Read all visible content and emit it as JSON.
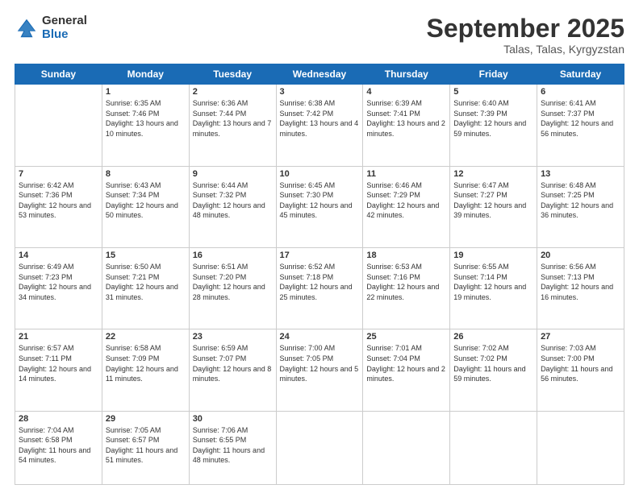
{
  "logo": {
    "general": "General",
    "blue": "Blue"
  },
  "title": "September 2025",
  "location": "Talas, Talas, Kyrgyzstan",
  "days_of_week": [
    "Sunday",
    "Monday",
    "Tuesday",
    "Wednesday",
    "Thursday",
    "Friday",
    "Saturday"
  ],
  "weeks": [
    [
      {
        "day": null,
        "info": null
      },
      {
        "day": "1",
        "sunrise": "Sunrise: 6:35 AM",
        "sunset": "Sunset: 7:46 PM",
        "daylight": "Daylight: 13 hours and 10 minutes."
      },
      {
        "day": "2",
        "sunrise": "Sunrise: 6:36 AM",
        "sunset": "Sunset: 7:44 PM",
        "daylight": "Daylight: 13 hours and 7 minutes."
      },
      {
        "day": "3",
        "sunrise": "Sunrise: 6:38 AM",
        "sunset": "Sunset: 7:42 PM",
        "daylight": "Daylight: 13 hours and 4 minutes."
      },
      {
        "day": "4",
        "sunrise": "Sunrise: 6:39 AM",
        "sunset": "Sunset: 7:41 PM",
        "daylight": "Daylight: 13 hours and 2 minutes."
      },
      {
        "day": "5",
        "sunrise": "Sunrise: 6:40 AM",
        "sunset": "Sunset: 7:39 PM",
        "daylight": "Daylight: 12 hours and 59 minutes."
      },
      {
        "day": "6",
        "sunrise": "Sunrise: 6:41 AM",
        "sunset": "Sunset: 7:37 PM",
        "daylight": "Daylight: 12 hours and 56 minutes."
      }
    ],
    [
      {
        "day": "7",
        "sunrise": "Sunrise: 6:42 AM",
        "sunset": "Sunset: 7:36 PM",
        "daylight": "Daylight: 12 hours and 53 minutes."
      },
      {
        "day": "8",
        "sunrise": "Sunrise: 6:43 AM",
        "sunset": "Sunset: 7:34 PM",
        "daylight": "Daylight: 12 hours and 50 minutes."
      },
      {
        "day": "9",
        "sunrise": "Sunrise: 6:44 AM",
        "sunset": "Sunset: 7:32 PM",
        "daylight": "Daylight: 12 hours and 48 minutes."
      },
      {
        "day": "10",
        "sunrise": "Sunrise: 6:45 AM",
        "sunset": "Sunset: 7:30 PM",
        "daylight": "Daylight: 12 hours and 45 minutes."
      },
      {
        "day": "11",
        "sunrise": "Sunrise: 6:46 AM",
        "sunset": "Sunset: 7:29 PM",
        "daylight": "Daylight: 12 hours and 42 minutes."
      },
      {
        "day": "12",
        "sunrise": "Sunrise: 6:47 AM",
        "sunset": "Sunset: 7:27 PM",
        "daylight": "Daylight: 12 hours and 39 minutes."
      },
      {
        "day": "13",
        "sunrise": "Sunrise: 6:48 AM",
        "sunset": "Sunset: 7:25 PM",
        "daylight": "Daylight: 12 hours and 36 minutes."
      }
    ],
    [
      {
        "day": "14",
        "sunrise": "Sunrise: 6:49 AM",
        "sunset": "Sunset: 7:23 PM",
        "daylight": "Daylight: 12 hours and 34 minutes."
      },
      {
        "day": "15",
        "sunrise": "Sunrise: 6:50 AM",
        "sunset": "Sunset: 7:21 PM",
        "daylight": "Daylight: 12 hours and 31 minutes."
      },
      {
        "day": "16",
        "sunrise": "Sunrise: 6:51 AM",
        "sunset": "Sunset: 7:20 PM",
        "daylight": "Daylight: 12 hours and 28 minutes."
      },
      {
        "day": "17",
        "sunrise": "Sunrise: 6:52 AM",
        "sunset": "Sunset: 7:18 PM",
        "daylight": "Daylight: 12 hours and 25 minutes."
      },
      {
        "day": "18",
        "sunrise": "Sunrise: 6:53 AM",
        "sunset": "Sunset: 7:16 PM",
        "daylight": "Daylight: 12 hours and 22 minutes."
      },
      {
        "day": "19",
        "sunrise": "Sunrise: 6:55 AM",
        "sunset": "Sunset: 7:14 PM",
        "daylight": "Daylight: 12 hours and 19 minutes."
      },
      {
        "day": "20",
        "sunrise": "Sunrise: 6:56 AM",
        "sunset": "Sunset: 7:13 PM",
        "daylight": "Daylight: 12 hours and 16 minutes."
      }
    ],
    [
      {
        "day": "21",
        "sunrise": "Sunrise: 6:57 AM",
        "sunset": "Sunset: 7:11 PM",
        "daylight": "Daylight: 12 hours and 14 minutes."
      },
      {
        "day": "22",
        "sunrise": "Sunrise: 6:58 AM",
        "sunset": "Sunset: 7:09 PM",
        "daylight": "Daylight: 12 hours and 11 minutes."
      },
      {
        "day": "23",
        "sunrise": "Sunrise: 6:59 AM",
        "sunset": "Sunset: 7:07 PM",
        "daylight": "Daylight: 12 hours and 8 minutes."
      },
      {
        "day": "24",
        "sunrise": "Sunrise: 7:00 AM",
        "sunset": "Sunset: 7:05 PM",
        "daylight": "Daylight: 12 hours and 5 minutes."
      },
      {
        "day": "25",
        "sunrise": "Sunrise: 7:01 AM",
        "sunset": "Sunset: 7:04 PM",
        "daylight": "Daylight: 12 hours and 2 minutes."
      },
      {
        "day": "26",
        "sunrise": "Sunrise: 7:02 AM",
        "sunset": "Sunset: 7:02 PM",
        "daylight": "Daylight: 11 hours and 59 minutes."
      },
      {
        "day": "27",
        "sunrise": "Sunrise: 7:03 AM",
        "sunset": "Sunset: 7:00 PM",
        "daylight": "Daylight: 11 hours and 56 minutes."
      }
    ],
    [
      {
        "day": "28",
        "sunrise": "Sunrise: 7:04 AM",
        "sunset": "Sunset: 6:58 PM",
        "daylight": "Daylight: 11 hours and 54 minutes."
      },
      {
        "day": "29",
        "sunrise": "Sunrise: 7:05 AM",
        "sunset": "Sunset: 6:57 PM",
        "daylight": "Daylight: 11 hours and 51 minutes."
      },
      {
        "day": "30",
        "sunrise": "Sunrise: 7:06 AM",
        "sunset": "Sunset: 6:55 PM",
        "daylight": "Daylight: 11 hours and 48 minutes."
      },
      {
        "day": null,
        "info": null
      },
      {
        "day": null,
        "info": null
      },
      {
        "day": null,
        "info": null
      },
      {
        "day": null,
        "info": null
      }
    ]
  ]
}
